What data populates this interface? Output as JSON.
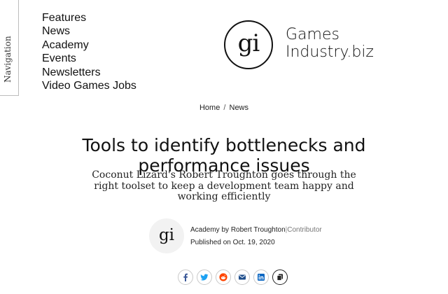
{
  "nav_tab": {
    "label": "Navigation"
  },
  "menu": [
    "Features",
    "News",
    "Academy",
    "Events",
    "Newsletters",
    "Video Games Jobs"
  ],
  "logo": {
    "mark": "gi",
    "line1": "Games",
    "line2": "Industry.biz"
  },
  "breadcrumb": {
    "home": "Home",
    "separator": "/",
    "section": "News"
  },
  "article": {
    "title": "Tools to identify bottlenecks and performance issues",
    "subtitle": "Coconut Lizard's Robert Troughton goes through the right toolset to keep a development team happy and working efficiently",
    "avatar_mark": "gi",
    "section": "Academy",
    "by": "by",
    "author": "Robert Troughton",
    "pipe": "|",
    "role": "Contributor",
    "published": "Published on Oct. 19, 2020"
  },
  "share": {
    "icons": [
      "facebook-icon",
      "twitter-icon",
      "reddit-icon",
      "email-icon",
      "linkedin-icon",
      "copy-icon"
    ],
    "colors": {
      "facebook": "#3b5998",
      "twitter": "#1da1f2",
      "reddit": "#ff4500",
      "email": "#1f4e8c",
      "linkedin": "#0a66c2",
      "copy": "#222222"
    }
  }
}
